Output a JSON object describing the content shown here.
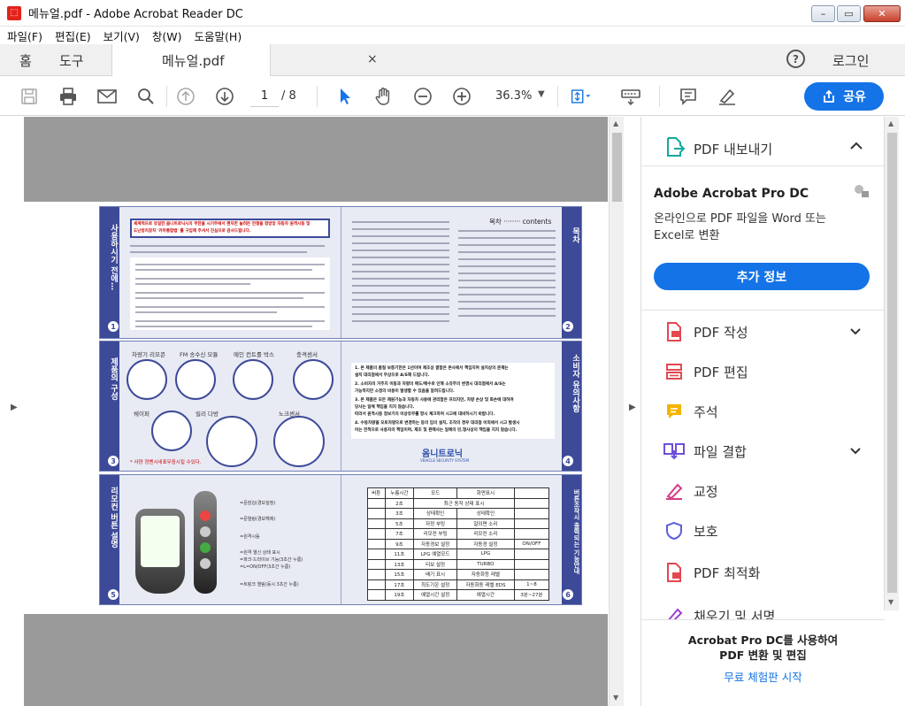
{
  "window": {
    "title": "메뉴얼.pdf - Adobe Acrobat Reader DC",
    "app_icon": "pdf-icon",
    "minimize": "–",
    "maximize": "▭",
    "close": "✕"
  },
  "menu": [
    "파일(F)",
    "편집(E)",
    "보기(V)",
    "창(W)",
    "도움말(H)"
  ],
  "tabs": {
    "home": "홈",
    "tools": "도구",
    "document": "메뉴얼.pdf",
    "close": "×",
    "help": "?",
    "login": "로그인"
  },
  "toolbar": {
    "page_current": "1",
    "page_total": "/ 8",
    "zoom": "36.3%",
    "share_label": "공유",
    "icons": [
      "save-icon",
      "print-icon",
      "email-icon",
      "search-icon",
      "page-up-icon",
      "page-down-icon",
      "select-cursor-icon",
      "hand-tool-icon",
      "zoom-out-icon",
      "zoom-in-icon",
      "fit-page-icon",
      "keyboard-icon",
      "comment-icon",
      "sign-icon"
    ]
  },
  "pdf_page": {
    "panel1_left_band": "사용하시기 전에…",
    "panel1_right_band": "목차",
    "panel1_heading_line1": "세계적으로 유일한 옵니트로닉시의 부한을 시기주에서 편자한 늘려든 전쟁을 정방망 자동차 원격시동 및",
    "panel1_heading_line2": "도난방지장치 '카마통합법' 를 구입해 주셔서 진심으로 감사드립니다.",
    "panel1_toc_title": "목차 ········ contents",
    "panel2_left_band": "제품의 구성",
    "panel2_right_band": "소비자 유의사항",
    "panel2_items": [
      "차량기 리모콘",
      "FM 송수신 모듈",
      "메인 컨트롤 박스",
      "충격센서",
      "쉐이퍼",
      "릴리 다방",
      "노크센서"
    ],
    "panel2_footnote": "* 사양 정벤시네표무중시킬 수있다.",
    "panel2_notes": [
      "1. 본 제품의 품질 보증기한은 1년이며 제조상 결함은 본사에서 책임지며 설치상의 문제는",
      "   설치 대리점에서 무상으로 A/S해 드립니다.",
      "2. 소비자의 거주지 이동과 차량의 매도/매수로 인해 소유주의 변경시 대리점에서 A/S는",
      "   가능하지만 소정의 비용이 발생할 수 있음을 알려드립니다.",
      "3. 본 제품은 모든 제원기능과 자동차 사용에 관리함은 프리지만, 차량 손상 및 화손에 대하여",
      "   당사는 일체 책임을 지지 않습니다.",
      "   따라서 원격시동 정보기의 이상유무를 항시 체크하여 시고에 대비하시기 바랍니다.",
      "4. 수동차량을 오토차량으로 변경하는 등의 임의 설치, 조작의 경우 대리점 이외에서 시고 발생시",
      "   이는 전적으로 사용자의 책임이며, 제조 및 판매사는 일체의 민,형사상의 책임을 지지 않습니다."
    ],
    "panel2_logo": "옴니트로닉",
    "panel2_logo_sub": "VEHICLE SECURITY SYSTEM",
    "panel3_left_band": "리모컨 버튼 설명",
    "panel3_right_band": "버튼조작시 출력되는 기능안내",
    "panel3_buttons": [
      "=문잠김(경보설정)",
      "=문열림(경보해제)",
      "=원격시동",
      "=원격 열신 상태 표시",
      "=파크·드라이브 기능(3초간 누름)",
      "=L=ON/OFF(3초간 누름)",
      "=트렁크 열림(동시 3초간 누름)"
    ],
    "panel3_table": {
      "headers": [
        "버튼",
        "누름시간",
        "모드",
        "화면표시"
      ],
      "rows": [
        [
          "",
          "2초",
          "최근 동작 상태 표시",
          ""
        ],
        [
          "",
          "3초",
          "상태확인",
          "상태확인"
        ],
        [
          "",
          "5초",
          "자정 부팅",
          "알려면 소리"
        ],
        [
          "",
          "7초",
          "리모컨 부팅",
          "리모컨 소리"
        ],
        [
          "",
          "9초",
          "자동경보 설정",
          "자동경 설정"
        ],
        [
          "",
          "11초",
          "LPG 예열모드",
          "LPG"
        ],
        [
          "",
          "13초",
          "터보 설정",
          "TURBO"
        ],
        [
          "",
          "15초",
          "배기 표시",
          "자동화등 레벨"
        ],
        [
          "",
          "17초",
          "최도기온 설정",
          "자동화동 레벨 EDS"
        ],
        [
          "",
          "19초",
          "예열시간 설정",
          "예열시간"
        ]
      ],
      "side_col": [
        "ON/OFF",
        "1~8",
        "3분~27분"
      ]
    },
    "page_numbers": [
      "1",
      "2",
      "3",
      "4",
      "5",
      "6"
    ]
  },
  "side_panel": {
    "export_title": "PDF 내보내기",
    "export_chevron": "⌃",
    "promo_title": "Adobe Acrobat Pro DC",
    "promo_desc": "온라인으로 PDF 파일을 Word 또는 Excel로 변환",
    "more_info": "추가 정보",
    "tools": [
      {
        "label": "PDF 작성",
        "icon": "create-pdf-icon",
        "color": "#e34850",
        "chevron": true
      },
      {
        "label": "PDF 편집",
        "icon": "edit-pdf-icon",
        "color": "#e34850",
        "chevron": false
      },
      {
        "label": "주석",
        "icon": "comment-icon",
        "color": "#e0a800",
        "chevron": false
      },
      {
        "label": "파일 결합",
        "icon": "combine-files-icon",
        "color": "#6f4fd9",
        "chevron": true
      },
      {
        "label": "교정",
        "icon": "redact-icon",
        "color": "#d53c87",
        "chevron": false
      },
      {
        "label": "보호",
        "icon": "protect-icon",
        "color": "#5b5fd9",
        "chevron": false
      },
      {
        "label": "PDF 최적화",
        "icon": "optimize-pdf-icon",
        "color": "#e34850",
        "chevron": false
      },
      {
        "label": "채우기 및 서명",
        "icon": "fill-sign-icon",
        "color": "#9b3fd1",
        "chevron": false
      }
    ],
    "footer_line1": "Acrobat Pro DC를 사용하여",
    "footer_line2": "PDF 변환 및 편집",
    "trial_link": "무료 체험판 시작"
  },
  "colors": {
    "accent": "#1473e6",
    "panel_band": "#3d4a98",
    "doc_gray": "#9a9a9a"
  }
}
